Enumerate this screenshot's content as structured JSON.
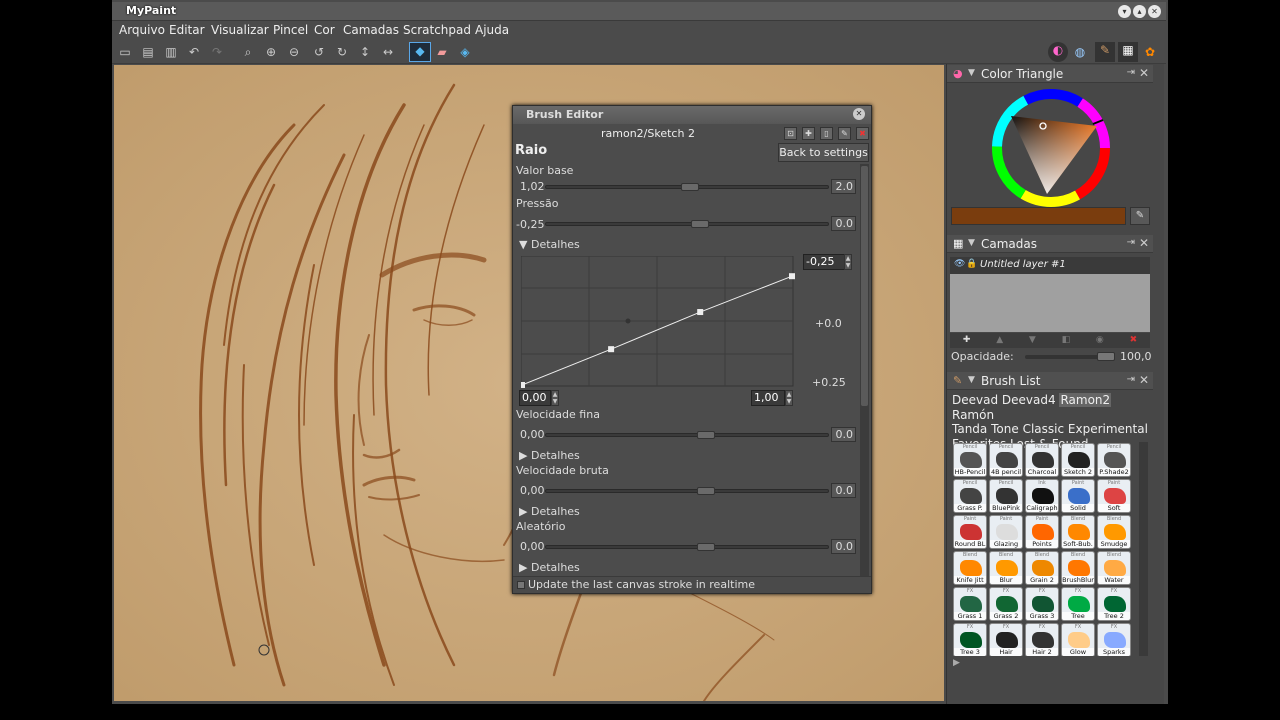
{
  "window": {
    "title": "MyPaint"
  },
  "menu": [
    "Arquivo",
    "Editar",
    "Visualizar",
    "Pincel",
    "Cor",
    "Camadas",
    "Scratchpad",
    "Ajuda"
  ],
  "toolbar_icons": [
    "new-icon",
    "open-icon",
    "save-icon",
    "undo-icon",
    "redo-icon",
    "zoom-reset-icon",
    "zoom-in-icon",
    "zoom-out-icon",
    "rotate-left-icon",
    "rotate-right-icon",
    "flip-vertical-icon",
    "flip-horizontal-icon",
    "brush-mode-icon",
    "eraser-icon",
    "lock-alpha-icon"
  ],
  "panel_toggle_icons": [
    "color-wheel-icon",
    "hsv-icon",
    "brush-icon",
    "layers-icon",
    "palette-icon"
  ],
  "color_triangle": {
    "title": "Color Triangle",
    "current_color": "#7a3d0e"
  },
  "layers": {
    "title": "Camadas",
    "layer_name": "Untitled layer #1",
    "opacity_label": "Opacidade:",
    "opacity_value": "100,0"
  },
  "brush_list": {
    "title": "Brush List",
    "groups": [
      "Deevad",
      "Deevad4",
      "Ramon2",
      "Ramón",
      "Tanda",
      "Tone",
      "Classic",
      "Experimental",
      "Favorites",
      "Lost & Found"
    ],
    "selected_group": "Ramon2",
    "brushes": [
      {
        "tag": "Pencil",
        "label": "HB-Pencil",
        "color": "#555"
      },
      {
        "tag": "Pencil",
        "label": "4B pencil",
        "color": "#444"
      },
      {
        "tag": "Pencil",
        "label": "Charcoal",
        "color": "#333"
      },
      {
        "tag": "Pencil",
        "label": "Sketch 2",
        "color": "#222"
      },
      {
        "tag": "Pencil",
        "label": "P.Shade2",
        "color": "#555"
      },
      {
        "tag": "Pencil",
        "label": "Grass P.",
        "color": "#444"
      },
      {
        "tag": "Pencil",
        "label": "BluePink",
        "color": "#333"
      },
      {
        "tag": "Ink",
        "label": "Caligraph",
        "color": "#111"
      },
      {
        "tag": "Paint",
        "label": "Solid",
        "color": "#3a6fc9"
      },
      {
        "tag": "Paint",
        "label": "Soft",
        "color": "#d44"
      },
      {
        "tag": "Paint",
        "label": "Round BL",
        "color": "#c33"
      },
      {
        "tag": "Paint",
        "label": "Glazing",
        "color": "#ddd"
      },
      {
        "tag": "Paint",
        "label": "Points",
        "color": "#f60"
      },
      {
        "tag": "Blend",
        "label": "Soft-Bub.",
        "color": "#f80"
      },
      {
        "tag": "Blend",
        "label": "Smudge",
        "color": "#f90"
      },
      {
        "tag": "Blend",
        "label": "Knife Jitt",
        "color": "#f80"
      },
      {
        "tag": "Blend",
        "label": "Blur",
        "color": "#f90"
      },
      {
        "tag": "Blend",
        "label": "Grain 2",
        "color": "#e80"
      },
      {
        "tag": "Blend",
        "label": "BrushBlur",
        "color": "#f70"
      },
      {
        "tag": "Blend",
        "label": "Water",
        "color": "#fa4"
      },
      {
        "tag": "FX",
        "label": "Grass 1",
        "color": "#264"
      },
      {
        "tag": "FX",
        "label": "Grass 2",
        "color": "#163"
      },
      {
        "tag": "FX",
        "label": "Grass 3",
        "color": "#153"
      },
      {
        "tag": "FX",
        "label": "Tree",
        "color": "#0a4"
      },
      {
        "tag": "FX",
        "label": "Tree 2",
        "color": "#063"
      },
      {
        "tag": "FX",
        "label": "Tree 3",
        "color": "#052"
      },
      {
        "tag": "FX",
        "label": "Hair",
        "color": "#222"
      },
      {
        "tag": "FX",
        "label": "Hair 2",
        "color": "#333"
      },
      {
        "tag": "FX",
        "label": "Glow",
        "color": "#fc8"
      },
      {
        "tag": "FX",
        "label": "Sparks",
        "color": "#8af"
      }
    ]
  },
  "brush_editor": {
    "title": "Brush Editor",
    "brush_name": "ramon2/Sketch 2",
    "setting": "Raio",
    "back_button": "Back to settings",
    "base_value_label": "Valor base",
    "base_value": "1,02",
    "base_value_max": "2.0",
    "base_value_fraction": 0.51,
    "inputs": [
      {
        "label": "Pressão",
        "value": "-0,25",
        "max": "0.0",
        "fraction": 0.55
      },
      {
        "label": "Velocidade fina",
        "value": "0,00",
        "max": "0.0",
        "fraction": 0.57
      },
      {
        "label": "Velocidade bruta",
        "value": "0,00",
        "max": "0.0",
        "fraction": 0.57
      },
      {
        "label": "Aleatório",
        "value": "0,00",
        "max": "0.0",
        "fraction": 0.57
      }
    ],
    "details_label": "Detalhes",
    "curve": {
      "y_top": "-0,25",
      "y_mid": "+0.0",
      "y_bottom": "+0.25",
      "x_min": "0,00",
      "x_max": "1,00",
      "points": [
        [
          0,
          0
        ],
        [
          0.33,
          0.28
        ],
        [
          0.66,
          0.57
        ],
        [
          1,
          0.85
        ]
      ]
    },
    "realtime_label": "Update the last canvas stroke in realtime"
  }
}
